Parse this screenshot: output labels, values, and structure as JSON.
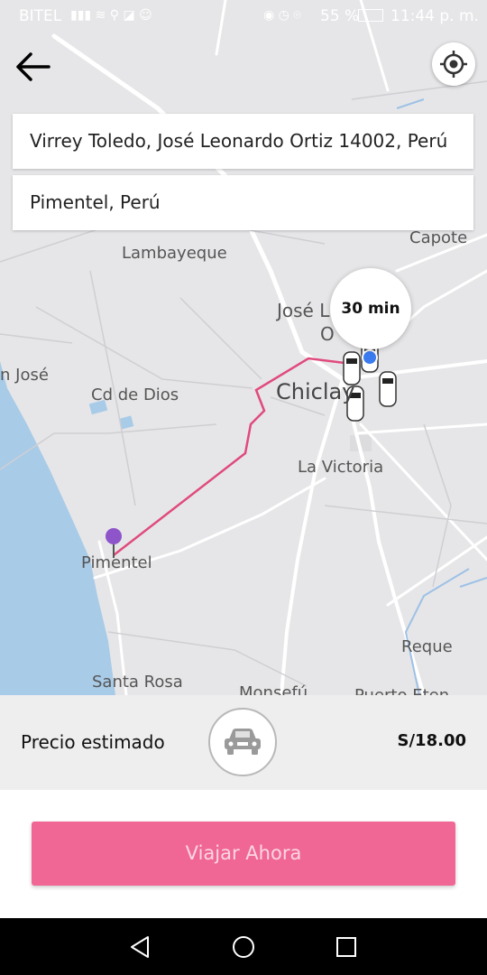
{
  "status_bar": {
    "carrier": "BITEL",
    "battery": "55 %",
    "time": "11:44 p. m."
  },
  "header": {
    "back_icon": "arrow-left-icon",
    "locate_icon": "crosshair-icon"
  },
  "route": {
    "origin": "Virrey Toledo, José Leonardo Ortiz 14002, Perú",
    "destination": "Pimentel, Perú"
  },
  "map": {
    "labels": {
      "capote": "Capote",
      "lambayeque": "Lambayeque",
      "jose_l": "José L",
      "o": "O",
      "san_jose": "n José",
      "cd_de_dios": "Cd de Dios",
      "chiclayo": "Chiclay",
      "la_victoria": "La Victoria",
      "pimentel": "Pimentel",
      "reque": "Reque",
      "santa_rosa": "Santa Rosa",
      "monsefu": "Monsefú",
      "puerto_eten": "Puerto Eten"
    },
    "eta": "30 min",
    "route_color": "#e04a7c",
    "pin_color": "#8e54c9",
    "location_dot_color": "#3b7bf0"
  },
  "price": {
    "label": "Precio estimado",
    "value": "S/18.00",
    "vehicle_icon": "car-icon"
  },
  "action": {
    "button_label": "Viajar Ahora",
    "accent": "#f06795"
  },
  "nav": {
    "back": "triangle-back-icon",
    "home": "circle-home-icon",
    "recents": "square-recents-icon"
  }
}
